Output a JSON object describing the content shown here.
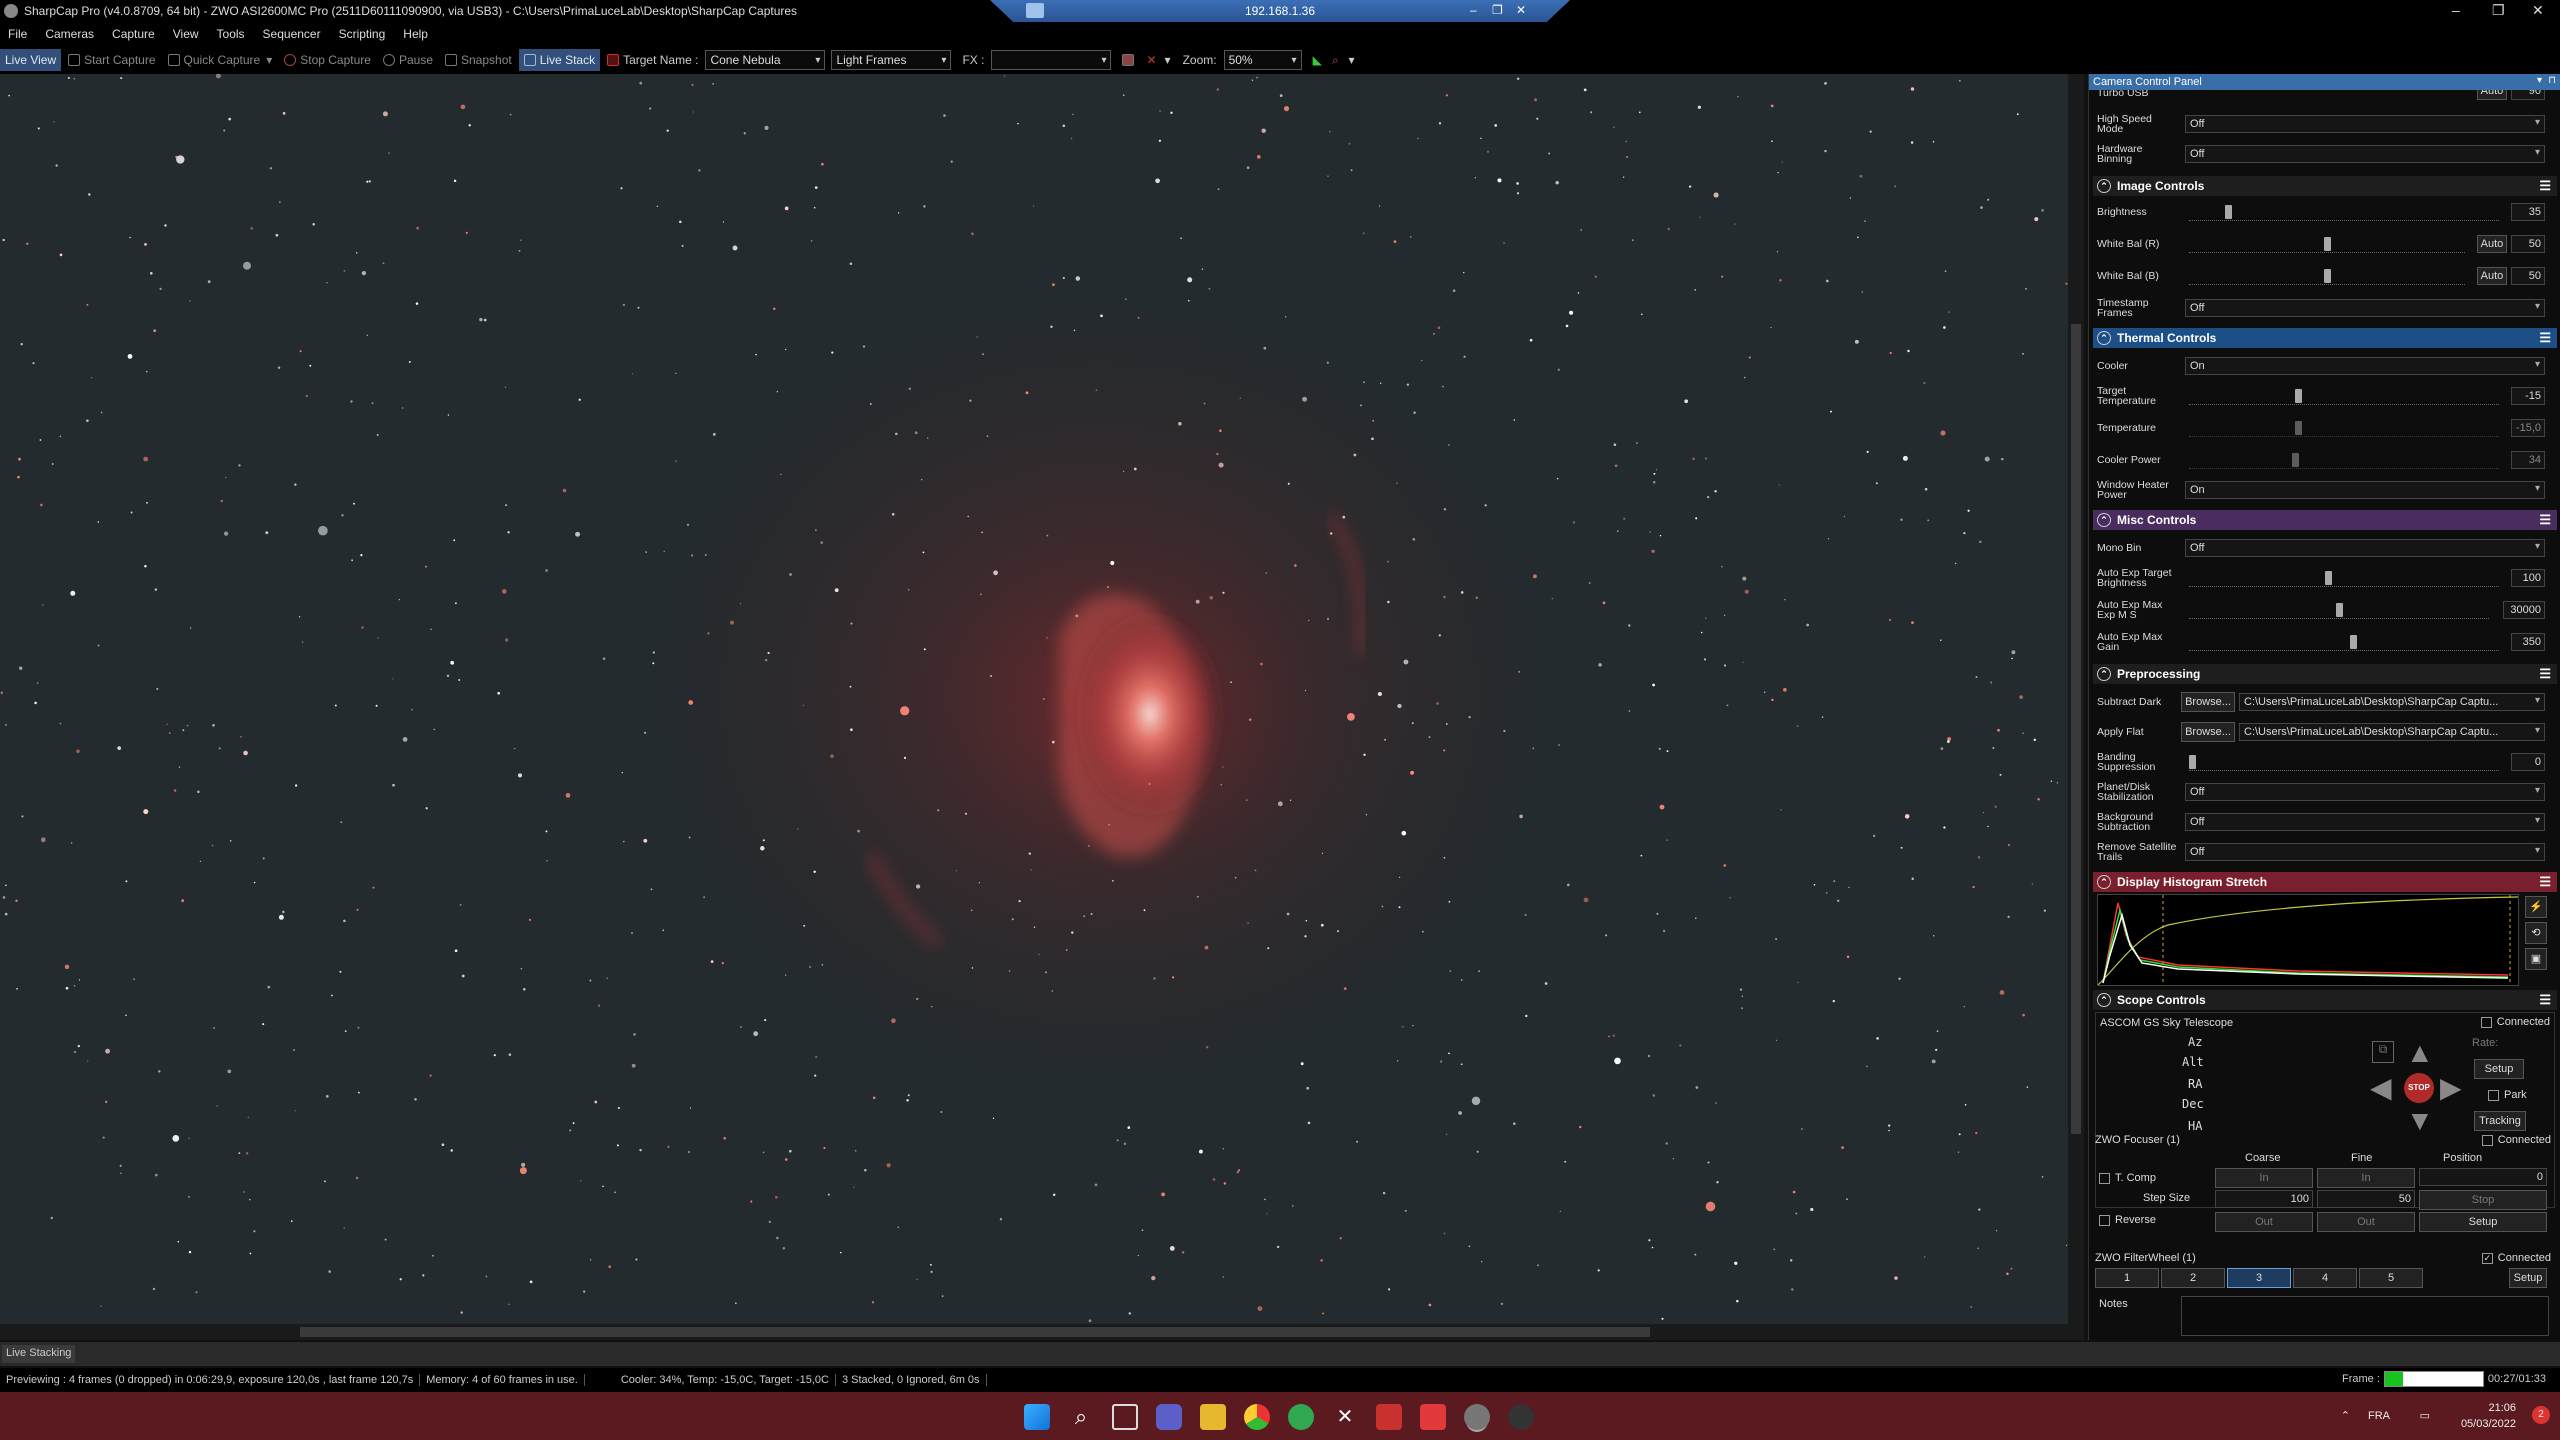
{
  "window": {
    "title": "SharpCap Pro (v4.0.8709, 64 bit) - ZWO ASI2600MC Pro (2511D60111090900, via USB3) - C:\\Users\\PrimaLuceLab\\Desktop\\SharpCap Captures",
    "remote_ip": "192.168.1.36"
  },
  "menu": [
    "File",
    "Cameras",
    "Capture",
    "View",
    "Tools",
    "Sequencer",
    "Scripting",
    "Help"
  ],
  "toolbar": {
    "live_view": "Live View",
    "start_capture": "Start Capture",
    "quick_capture": "Quick Capture",
    "stop_capture": "Stop Capture",
    "pause": "Pause",
    "snapshot": "Snapshot",
    "live_stack": "Live Stack",
    "target_name_label": "Target Name :",
    "target_name": "Cone Nebula",
    "frame_type": "Light Frames",
    "fx_label": "FX :",
    "fx_value": "",
    "zoom_label": "Zoom:",
    "zoom_value": "50%"
  },
  "panel": {
    "title": "Camera Control Panel",
    "turbo_usb": {
      "label": "Turbo USB",
      "auto": "Auto",
      "value": "90"
    },
    "high_speed_mode": {
      "label": "High Speed Mode",
      "value": "Off"
    },
    "hardware_binning": {
      "label": "Hardware Binning",
      "value": "Off"
    },
    "image_controls": {
      "title": "Image Controls",
      "brightness": {
        "label": "Brightness",
        "value": "35",
        "level": 0.12
      },
      "wb_r": {
        "label": "White Bal (R)",
        "auto": "Auto",
        "value": "50",
        "level": 0.5
      },
      "wb_b": {
        "label": "White Bal (B)",
        "auto": "Auto",
        "value": "50",
        "level": 0.5
      },
      "timestamp": {
        "label": "Timestamp Frames",
        "value": "Off"
      }
    },
    "thermal": {
      "title": "Thermal Controls",
      "cooler": {
        "label": "Cooler",
        "value": "On"
      },
      "target_temp": {
        "label": "Target Temperature",
        "value": "-15",
        "level": 0.35
      },
      "temperature": {
        "label": "Temperature",
        "value": "-15,0",
        "level": 0.35
      },
      "cooler_power": {
        "label": "Cooler Power",
        "value": "34",
        "level": 0.34
      },
      "window_heater": {
        "label": "Window Heater Power",
        "value": "On"
      }
    },
    "misc": {
      "title": "Misc Controls",
      "mono_bin": {
        "label": "Mono Bin",
        "value": "Off"
      },
      "ae_brightness": {
        "label": "Auto Exp Target Brightness",
        "value": "100",
        "level": 0.45
      },
      "ae_max_exp": {
        "label": "Auto Exp Max Exp M S",
        "value": "30000",
        "level": 0.5
      },
      "ae_max_gain": {
        "label": "Auto Exp Max Gain",
        "value": "350",
        "level": 0.53
      }
    },
    "preproc": {
      "title": "Preprocessing",
      "subtract_dark": {
        "label": "Subtract Dark",
        "browse": "Browse...",
        "path": "C:\\Users\\PrimaLuceLab\\Desktop\\SharpCap Captu..."
      },
      "apply_flat": {
        "label": "Apply Flat",
        "browse": "Browse...",
        "path": "C:\\Users\\PrimaLuceLab\\Desktop\\SharpCap Captu..."
      },
      "banding": {
        "label": "Banding Suppression",
        "value": "0",
        "level": 0.0
      },
      "planet_stab": {
        "label": "Planet/Disk Stabilization",
        "value": "Off"
      },
      "bg_sub": {
        "label": "Background Subtraction",
        "value": "Off"
      },
      "sat_trails": {
        "label": "Remove Satellite Trails",
        "value": "Off"
      }
    },
    "histogram": {
      "title": "Display Histogram Stretch"
    },
    "scope": {
      "title": "Scope Controls",
      "telescope": "ASCOM GS Sky Telescope",
      "connected": "Connected",
      "az": "Az",
      "alt": "Alt",
      "ra": "RA",
      "dec": "Dec",
      "ha": "HA",
      "rate": "Rate:",
      "setup": "Setup",
      "park": "Park",
      "tracking": "Tracking",
      "stop": "STOP"
    },
    "focuser": {
      "title": "ZWO Focuser (1)",
      "connected": "Connected",
      "coarse": "Coarse",
      "fine": "Fine",
      "position": "Position",
      "tcomp": "T. Comp",
      "in": "In",
      "out": "Out",
      "position_value": "0",
      "step_size": "Step Size",
      "coarse_step": "100",
      "fine_step": "50",
      "stop": "Stop",
      "reverse": "Reverse",
      "setup": "Setup"
    },
    "filterwheel": {
      "title": "ZWO FilterWheel (1)",
      "connected": "Connected",
      "slots": [
        "1",
        "2",
        "3",
        "4",
        "5"
      ],
      "setup": "Setup"
    },
    "notes": "Notes"
  },
  "live_stacking_tab": "Live Stacking",
  "status": {
    "previewing": "Previewing : 4 frames (0 dropped) in 0:06:29,9, exposure 120,0s , last frame 120,7s",
    "memory": "Memory: 4 of 60 frames in use.",
    "cooler": "Cooler: 34%, Temp: -15,0C, Target: -15,0C",
    "stacked": "3 Stacked, 0 Ignored, 6m 0s",
    "frame_label": "Frame :",
    "frame_progress": 0.18,
    "frame_time": "00:27/01:33"
  },
  "tray": {
    "lang": "FRA",
    "time": "21:06",
    "date": "05/03/2022"
  },
  "colors": {
    "image_control_bg": "#232323",
    "thermal_bg": "#1c4f86",
    "misc_bg": "#4a2d5e",
    "preproc_bg": "#232323",
    "histogram_bg": "#7a1f2e",
    "scope_bg": "#232323",
    "taskbar": "#5a1a1f"
  }
}
